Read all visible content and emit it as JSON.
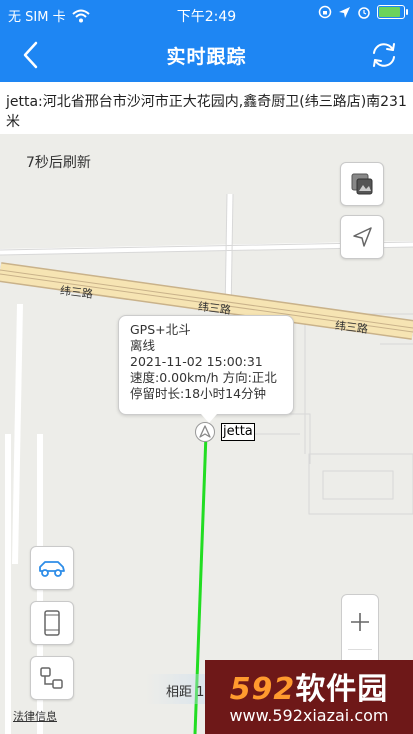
{
  "status_bar": {
    "carrier": "无 SIM 卡",
    "time": "下午2:49",
    "battery_level": 0.9,
    "battery_color": "#6bd35c"
  },
  "nav": {
    "title": "实时跟踪",
    "back_icon": "chevron-left-icon",
    "refresh_icon": "refresh-icon",
    "color": "#1e86f3"
  },
  "address": "jetta:河北省邢台市沙河市正大花园内,鑫奇厨卫(纬三路店)南231米",
  "map": {
    "refresh_countdown": "7秒后刷新",
    "road_label": "纬三路",
    "info": {
      "positioning": "GPS+北斗",
      "status": "离线",
      "datetime": "2021-11-02 15:00:31",
      "speed_direction": "速度:0.00km/h 方向:正北",
      "dwell_time": "停留时长:18小时14分钟"
    },
    "vehicle_label": "jetta",
    "distance_text": "相距 15…",
    "legal_link": "法律信息",
    "track_color": "#22dd22"
  },
  "watermark": {
    "brand_num": "592",
    "brand_cn": "软件园",
    "url": "www.592xiazai.com"
  }
}
